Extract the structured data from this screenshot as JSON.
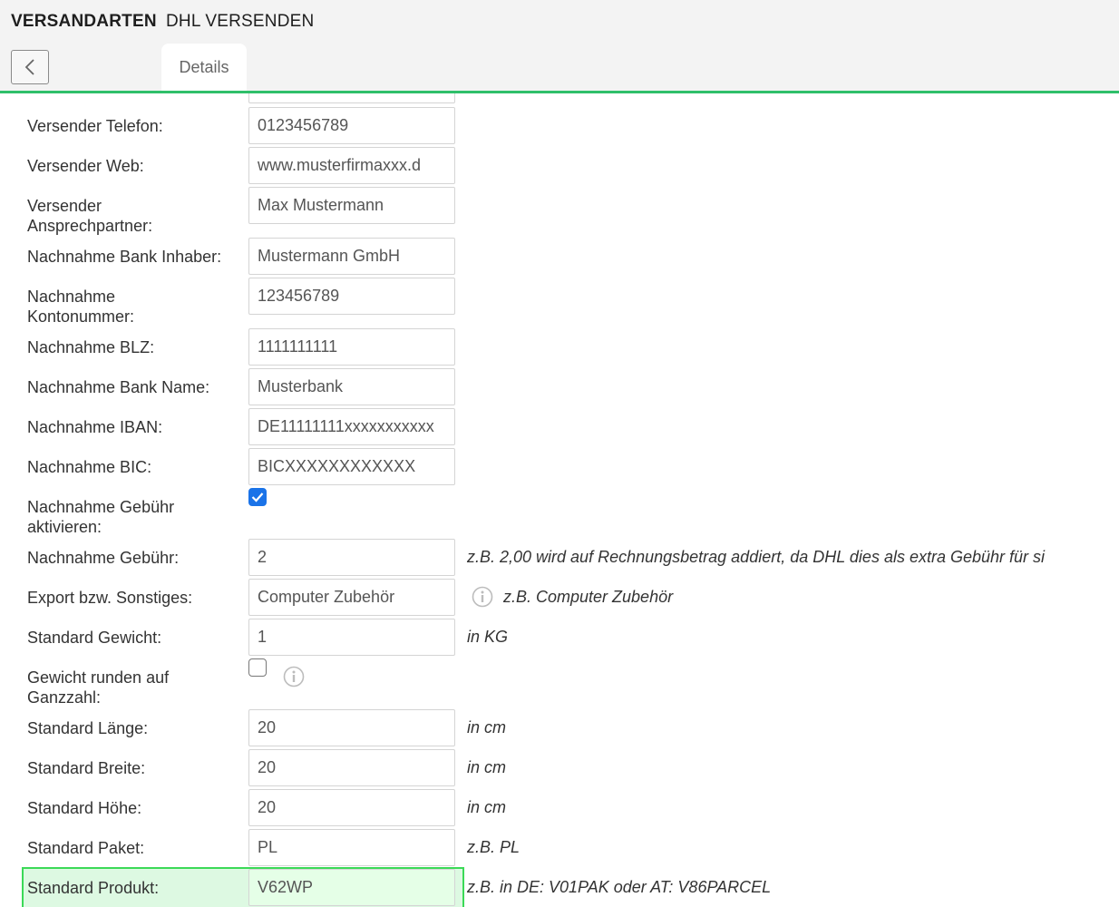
{
  "header": {
    "title": "VERSANDARTEN",
    "subtitle": "DHL VERSENDEN"
  },
  "tabs": [
    {
      "label": "Details"
    }
  ],
  "fields": [
    {
      "label": "Versender Telefon:",
      "value": "0123456789"
    },
    {
      "label": "Versender Web:",
      "value": "www.musterfirmaxxx.d"
    },
    {
      "label": "Versender Ansprechpartner:",
      "value": "Max Mustermann"
    },
    {
      "label": "Nachnahme Bank Inhaber:",
      "value": "Mustermann GmbH"
    },
    {
      "label": "Nachnahme Kontonummer:",
      "value": "123456789"
    },
    {
      "label": "Nachnahme BLZ:",
      "value": "1111111111"
    },
    {
      "label": "Nachnahme Bank Name:",
      "value": "Musterbank"
    },
    {
      "label": "Nachnahme IBAN:",
      "value": "DE11111111xxxxxxxxxxx"
    },
    {
      "label": "Nachnahme BIC:",
      "value": "BICXXXXXXXXXXXX"
    },
    {
      "label": "Nachnahme Gebühr aktivieren:",
      "checked": true
    },
    {
      "label": "Nachnahme Gebühr:",
      "value": "2",
      "hint": "z.B. 2,00 wird auf Rechnungsbetrag addiert, da DHL dies als extra Gebühr für si"
    },
    {
      "label": "Export bzw. Sonstiges:",
      "value": "Computer Zubehör",
      "hint": "z.B. Computer Zubehör"
    },
    {
      "label": "Standard Gewicht:",
      "value": "1",
      "hint": "in KG"
    },
    {
      "label": "Gewicht runden auf Ganzzahl:",
      "checked": false
    },
    {
      "label": "Standard Länge:",
      "value": "20",
      "hint": "in cm"
    },
    {
      "label": "Standard Breite:",
      "value": "20",
      "hint": "in cm"
    },
    {
      "label": "Standard Höhe:",
      "value": "20",
      "hint": "in cm"
    },
    {
      "label": "Standard Paket:",
      "value": "PL",
      "hint": "z.B. PL"
    },
    {
      "label": "Standard Produkt:",
      "value": "V62WP",
      "hint": "z.B. in DE: V01PAK oder AT: V86PARCEL"
    }
  ],
  "colors": {
    "accent": "#2fbf6a",
    "checkbox": "#1a73e8",
    "highlight": "#3bd957"
  }
}
